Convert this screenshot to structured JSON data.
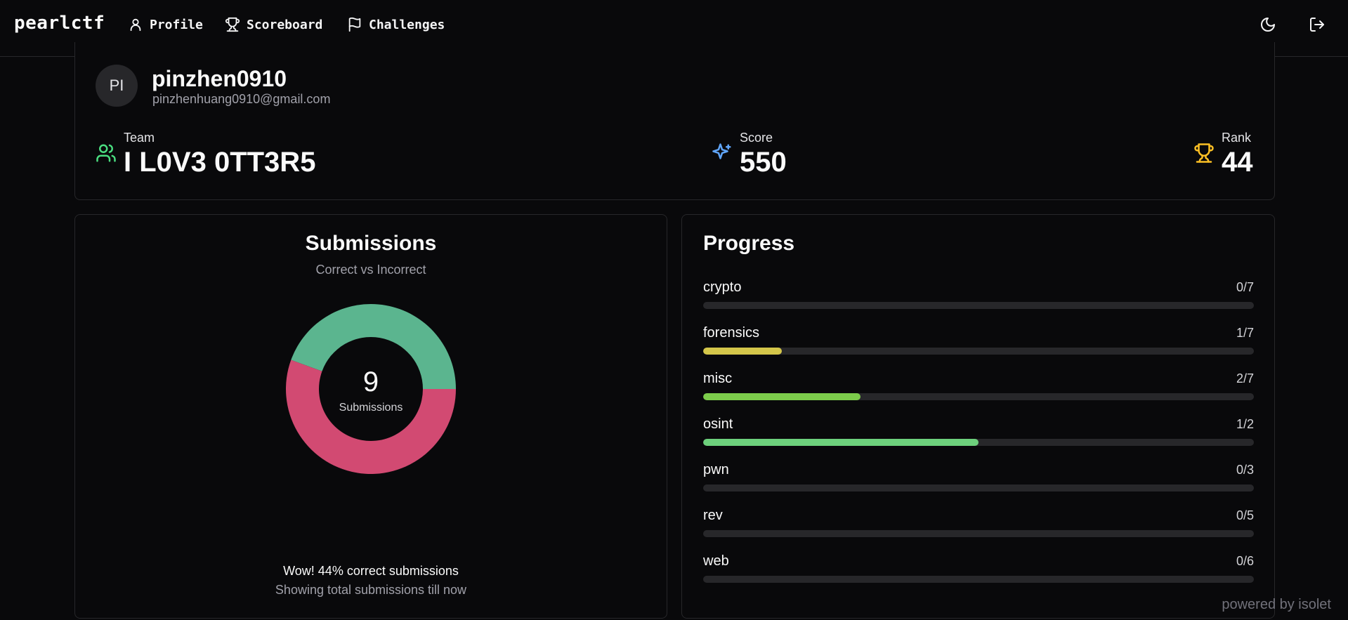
{
  "nav": {
    "brand": "pearlctf",
    "links": [
      {
        "label": "Profile",
        "icon": "user-icon"
      },
      {
        "label": "Scoreboard",
        "icon": "trophy-icon"
      },
      {
        "label": "Challenges",
        "icon": "flag-icon"
      }
    ],
    "actions": [
      {
        "icon": "moon-icon"
      },
      {
        "icon": "logout-icon"
      }
    ]
  },
  "profile": {
    "initials": "PI",
    "username": "pinzhen0910",
    "email": "pinzhenhuang0910@gmail.com",
    "stats": {
      "team": {
        "label": "Team",
        "value": "I L0V3 0TT3R5",
        "icon": "users-icon",
        "color": "#4ade80"
      },
      "score": {
        "label": "Score",
        "value": "550",
        "icon": "sparkles-icon",
        "color": "#60a5fa"
      },
      "rank": {
        "label": "Rank",
        "value": "44",
        "icon": "trophy-icon",
        "color": "#fbbf24"
      }
    }
  },
  "submissions": {
    "title": "Submissions",
    "subtitle": "Correct vs Incorrect",
    "total": "9",
    "total_label": "Submissions",
    "footer_primary": "Wow! 44% correct submissions",
    "footer_secondary": "Showing total submissions till now",
    "chart_data": {
      "type": "pie",
      "values": [
        4,
        5
      ],
      "colors": [
        "#5bb58f",
        "#d24a72"
      ]
    }
  },
  "progress": {
    "title": "Progress",
    "categories": [
      {
        "name": "crypto",
        "count": "0/7",
        "fraction": 0.0,
        "color": "#e5c546"
      },
      {
        "name": "forensics",
        "count": "1/7",
        "fraction": 0.1429,
        "color": "#d4c64a"
      },
      {
        "name": "misc",
        "count": "2/7",
        "fraction": 0.2857,
        "color": "#7ccc4b"
      },
      {
        "name": "osint",
        "count": "1/2",
        "fraction": 0.5,
        "color": "#6dd07c"
      },
      {
        "name": "pwn",
        "count": "0/3",
        "fraction": 0.0,
        "color": "#6dd07c"
      },
      {
        "name": "rev",
        "count": "0/5",
        "fraction": 0.0,
        "color": "#6dd07c"
      },
      {
        "name": "web",
        "count": "0/6",
        "fraction": 0.0,
        "color": "#6dd07c"
      }
    ]
  },
  "footer": {
    "powered_by": "powered by isolet"
  }
}
